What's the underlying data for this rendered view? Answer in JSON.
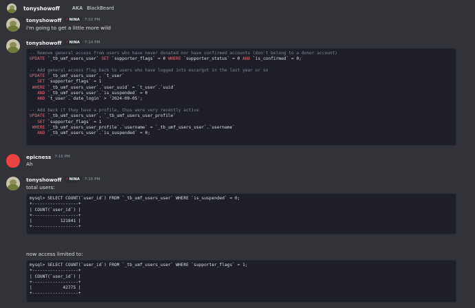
{
  "header": {
    "username": "tonyshowoff",
    "aka_label": "AKA",
    "aka_name": "BlackBeard"
  },
  "colors": {
    "background": "#313338",
    "code_bg": "#1e1f29",
    "keyword": "#e06c75",
    "comment": "#7f8694",
    "tag_icon": "#f23f43"
  },
  "messages": [
    {
      "author": "tonyshowoff",
      "tag": "NINA",
      "time": "7:02 PM",
      "text": "i'm going to get a little more wild"
    },
    {
      "author": "tonyshowoff",
      "tag": "NINA",
      "time": "7:14 PM",
      "code_lines": [
        "-- Remove general access from users who have never donated nor have confirmed accounts (don't belong to a donor account)",
        "UPDATE `_tb_umf_users_user` SET `supporter_flags` = 0 WHERE `supporter_status` = 0 AND `is_confirmed` = 0;",
        "",
        "-- Add general access flag back to users who have logged into escargot in the last year or so",
        "UPDATE `_tb_umf_users_user`, `t_user`",
        "   SET `supporter_flags` = 1",
        " WHERE `_tb_umf_users_user`.`user_uuid` = `t_user`.`uuid`",
        "   AND `_tb_umf_users_user`.`is_suspended` = 0",
        "   AND `t_user`.`date_login` > '2024-09-05';",
        "",
        "-- Add back if they have a profile, thus were very recently active",
        "UPDATE `_tb_umf_users_user`, `_tb_umf_users_user_profile`",
        "   SET `supporter_flags` = 1",
        " WHERE `_tb_umf_users_user_profile`.`username` = `_tb_umf_users_user`.`username`",
        "   AND `_tb_umf_users_user`.`is_suspended` = 0;"
      ]
    },
    {
      "author": "epicness",
      "time": "7:15 PM",
      "text": "Ah"
    },
    {
      "author": "tonyshowoff",
      "tag": "NINA",
      "time": "7:15 PM",
      "text": "total users:",
      "code_lines": [
        "mysql> SELECT COUNT(`user_id`) FROM `_tb_umf_users_user` WHERE `is_suspended` = 0;",
        "+------------------+",
        "| COUNT(`user_id`) |",
        "+------------------+",
        "|           121841 |",
        "+------------------+"
      ],
      "text2": "now access limited to:",
      "code_lines2": [
        "mysql> SELECT COUNT(`user_id`) FROM `_tb_umf_users_user` WHERE `supporter_flags` = 1;",
        "+------------------+",
        "| COUNT(`user_id`) |",
        "+------------------+",
        "|            42775 |",
        "+------------------+"
      ]
    }
  ]
}
